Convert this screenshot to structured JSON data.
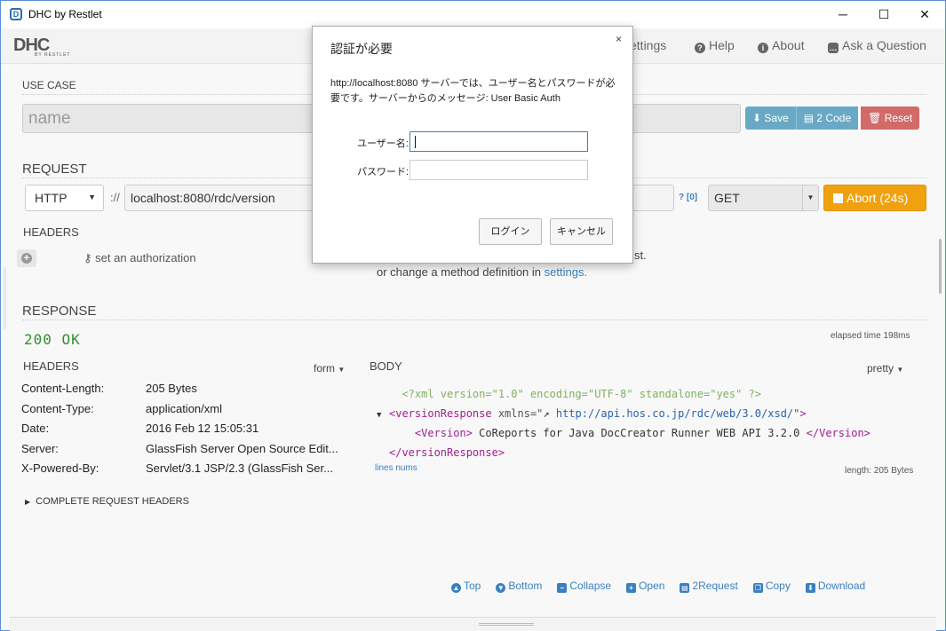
{
  "window": {
    "title": "DHC by Restlet",
    "minimize": "─",
    "maximize": "☐",
    "close": "✕"
  },
  "appbar": {
    "logo_big": "DHC",
    "logo_small": "BY RESTLET",
    "nav": {
      "settings": "ettings",
      "help": "Help",
      "about": "About",
      "ask": "Ask a Question"
    }
  },
  "usecase": {
    "label": "USE CASE",
    "name_placeholder": "name",
    "save": "Save",
    "code": "2 Code",
    "reset": "Reset"
  },
  "request": {
    "label": "REQUEST",
    "protocol": "HTTP",
    "separator": "://",
    "url": "localhost:8080/rdc/version",
    "query_link": "? [0]",
    "method": "GET",
    "abort": "Abort (24s)",
    "headers_label": "HEADERS",
    "auth_link": "set an authorization",
    "hint_tail": "st.",
    "hint_prefix": "or change a method definition in ",
    "hint_link": "settings."
  },
  "response": {
    "label": "RESPONSE",
    "status": "200 OK",
    "elapsed": "elapsed time 198ms",
    "headers_label": "HEADERS",
    "form_dropdown": "form",
    "body_label": "BODY",
    "pretty_dropdown": "pretty",
    "headers": [
      {
        "key": "Content-Length:",
        "value": "205 Bytes"
      },
      {
        "key": "Content-Type:",
        "value": "application/xml"
      },
      {
        "key": "Date:",
        "value": "2016 Feb 12 15:05:31"
      },
      {
        "key": "Server:",
        "value": "GlassFish Server Open Source Edit..."
      },
      {
        "key": "X-Powered-By:",
        "value": "Servlet/3.1 JSP/2.3 (GlassFish Ser..."
      }
    ],
    "xml": {
      "pi": "<?xml version=\"1.0\" encoding=\"UTF-8\" standalone=\"yes\" ?>",
      "open_tag": "<versionResponse",
      "attr": " xmlns=\"",
      "link": "http://api.hos.co.jp/rdc/web/3.0/xsd/",
      "attr_end": "\">",
      "version_open": "<Version>",
      "version_text": "CoReports for Java DocCreator Runner WEB API 3.2.0",
      "version_close": "</Version>",
      "close_tag": "</versionResponse>"
    },
    "lines_nums": "lines nums",
    "length": "length: 205 Bytes",
    "complete_request_headers": "COMPLETE REQUEST HEADERS"
  },
  "bottom_links": [
    {
      "name": "top",
      "label": "Top",
      "icon": "▲"
    },
    {
      "name": "bottom",
      "label": "Bottom",
      "icon": "▼"
    },
    {
      "name": "collapse",
      "label": "Collapse",
      "icon": "−"
    },
    {
      "name": "open",
      "label": "Open",
      "icon": "+"
    },
    {
      "name": "2request",
      "label": "2Request",
      "icon": "▤"
    },
    {
      "name": "copy",
      "label": "Copy",
      "icon": "❐"
    },
    {
      "name": "download",
      "label": "Download",
      "icon": "⬇"
    }
  ],
  "dialog": {
    "title": "認証が必要",
    "close": "×",
    "message": "http://localhost:8080 サーバーでは、ユーザー名とパスワードが必要です。サーバーからのメッセージ: User Basic Auth",
    "username_label": "ユーザー名:",
    "password_label": "パスワード:",
    "username_value": "",
    "password_value": "",
    "login": "ログイン",
    "cancel": "キャンセル"
  },
  "colors": {
    "accent_blue": "#3a80c0",
    "save_button": "#69a9c6",
    "reset_button": "#d16a69",
    "abort_button": "#f0a10e",
    "status_ok": "#2f8f2f"
  }
}
